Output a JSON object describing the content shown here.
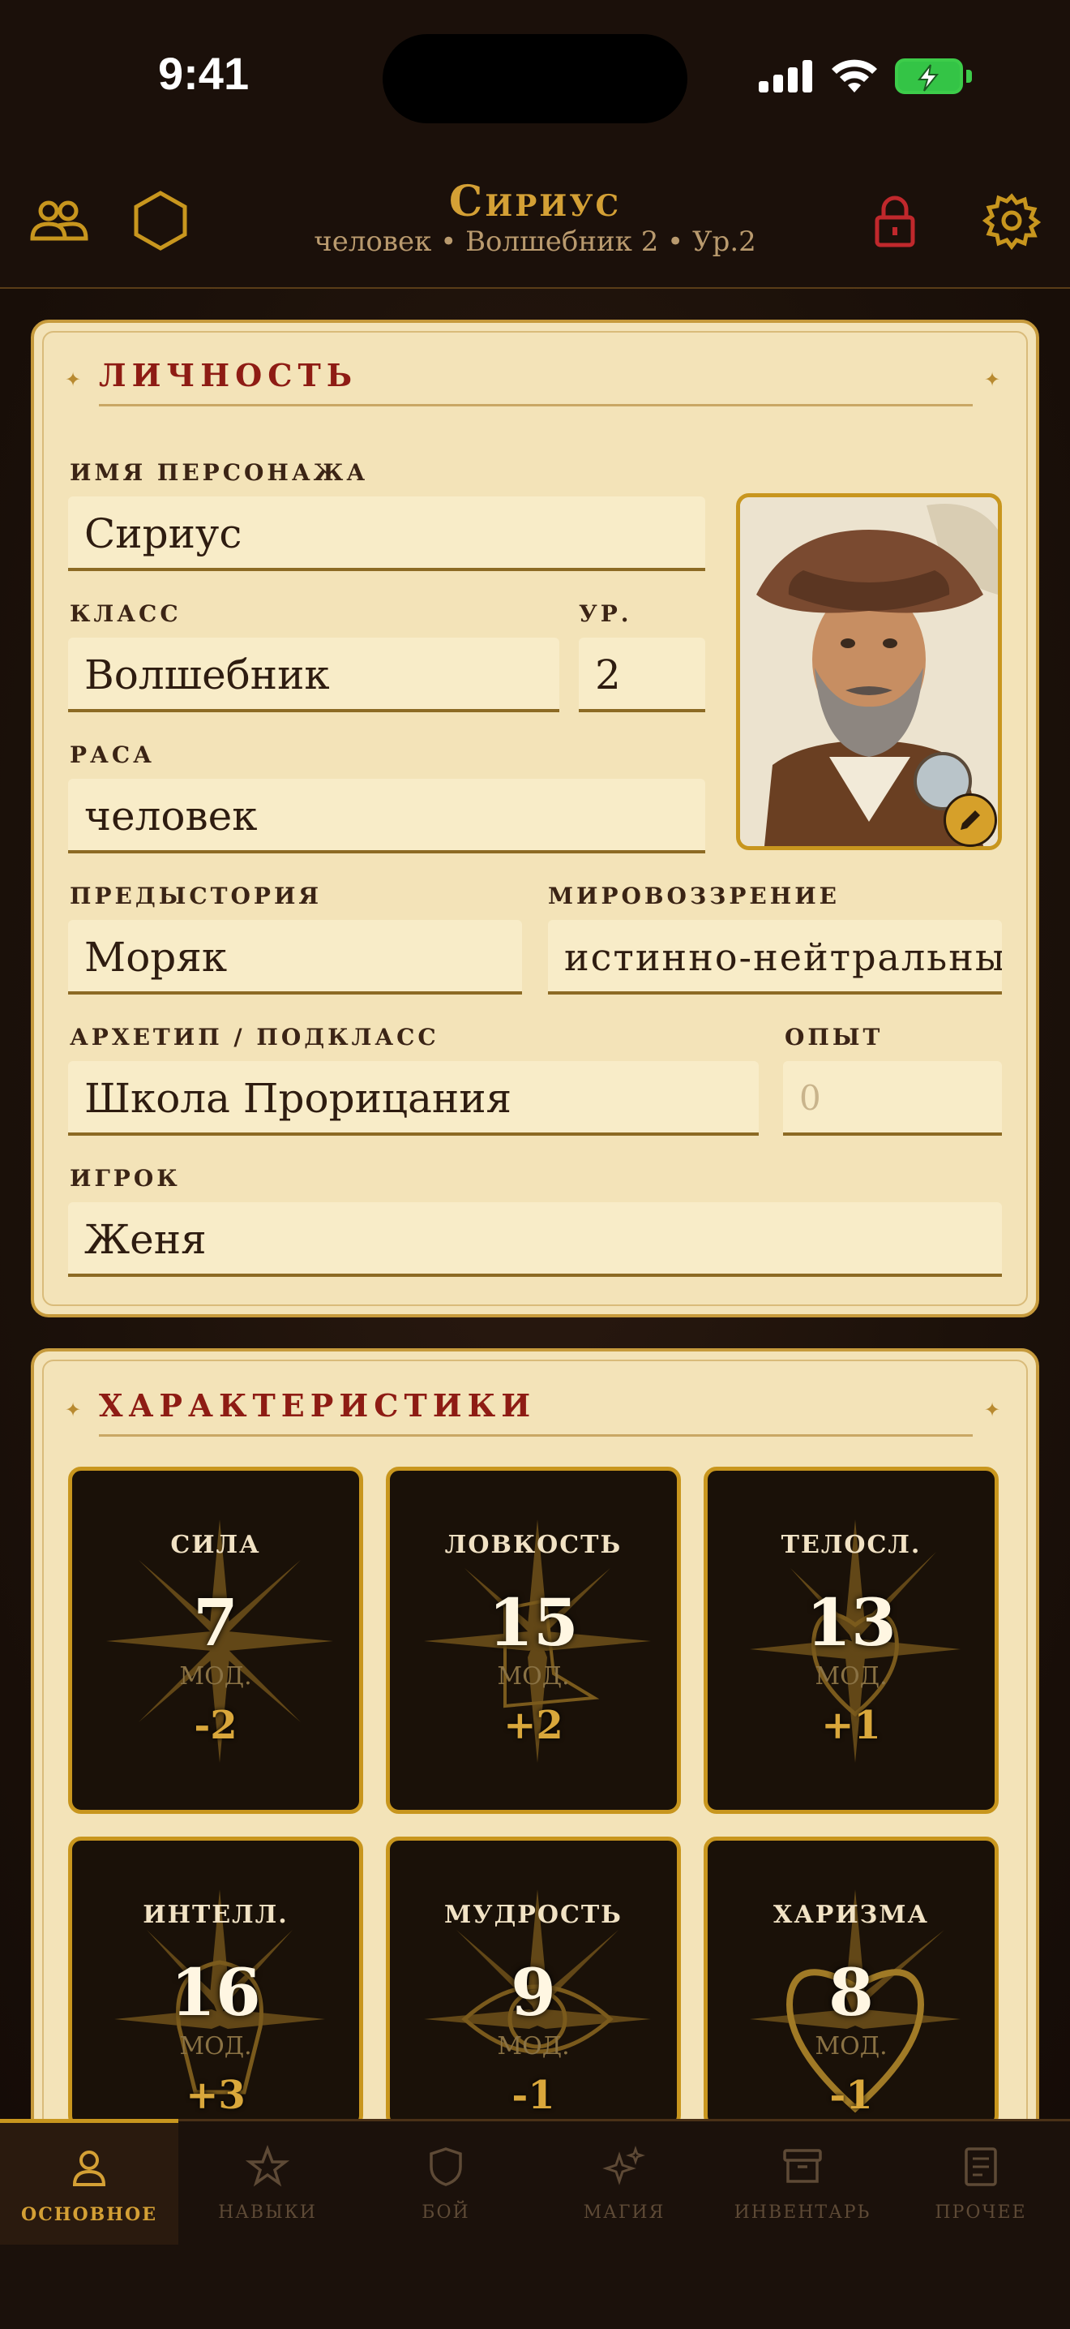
{
  "status_bar": {
    "time": "9:41"
  },
  "header": {
    "title": "Сириус",
    "subtitle": "человек • Волшебник 2 • Ур.2"
  },
  "personality": {
    "title": "ЛИЧНОСТЬ",
    "name_label": "ИМЯ ПЕРСОНАЖА",
    "name_value": "Сириус",
    "class_label": "КЛАСС",
    "class_value": "Волшебник",
    "level_label": "УР.",
    "level_value": "2",
    "race_label": "РАСА",
    "race_value": "человек",
    "background_label": "ПРЕДЫСТОРИЯ",
    "background_value": "Моряк",
    "alignment_label": "МИРОВОЗЗРЕНИЕ",
    "alignment_value": "истинно-нейтральный",
    "subclass_label": "АРХЕТИП / ПОДКЛАСС",
    "subclass_value": "Школа Прорицания",
    "xp_label": "ОПЫТ",
    "xp_placeholder": "0",
    "player_label": "ИГРОК",
    "player_value": "Женя"
  },
  "abilities": {
    "title": "ХАРАКТЕРИСТИКИ",
    "mod_label": "МОД.",
    "items": [
      {
        "name": "СИЛА",
        "value": "7",
        "mod": "-2"
      },
      {
        "name": "ЛОВКОСТЬ",
        "value": "15",
        "mod": "+2"
      },
      {
        "name": "ТЕЛОСЛ.",
        "value": "13",
        "mod": "+1"
      },
      {
        "name": "ИНТЕЛЛ.",
        "value": "16",
        "mod": "+3"
      },
      {
        "name": "МУДРОСТЬ",
        "value": "9",
        "mod": "-1"
      },
      {
        "name": "ХАРИЗМА",
        "value": "8",
        "mod": "-1"
      }
    ]
  },
  "tabs": [
    {
      "label": "ОСНОВНОЕ",
      "icon": "person-icon"
    },
    {
      "label": "НАВЫКИ",
      "icon": "star-icon"
    },
    {
      "label": "БОЙ",
      "icon": "shield-icon"
    },
    {
      "label": "МАГИЯ",
      "icon": "sparkles-icon"
    },
    {
      "label": "ИНВЕНТАРЬ",
      "icon": "archive-box-icon"
    },
    {
      "label": "ПРОЧЕЕ",
      "icon": "document-icon"
    }
  ],
  "colors": {
    "background": "#1b100a",
    "accent_gold": "#c8961e",
    "title_red": "#8e1c14",
    "parchment": "#f3e3b8",
    "lock_red": "#c0282c"
  }
}
